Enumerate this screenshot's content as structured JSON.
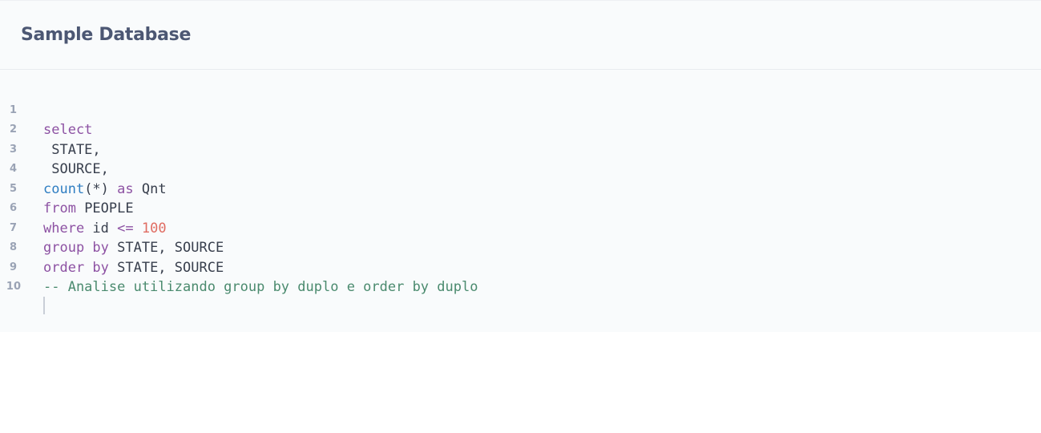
{
  "header": {
    "title": "Sample Database"
  },
  "editor": {
    "line_numbers": [
      "1",
      "2",
      "3",
      "4",
      "5",
      "6",
      "7",
      "8",
      "9",
      "10"
    ],
    "lines": {
      "l1": {
        "kw": "select"
      },
      "l2": {
        "text": " STATE,"
      },
      "l3": {
        "text": " SOURCE,"
      },
      "l4": {
        "fn": "count",
        "text1": "(*) ",
        "kw": "as",
        "text2": " Qnt"
      },
      "l5": {
        "kw": "from",
        "text": " PEOPLE"
      },
      "l6": {
        "kw": "where",
        "text": " id ",
        "op": "<=",
        "sp": " ",
        "num": "100"
      },
      "l7": {
        "kw": "group by",
        "text": " STATE, SOURCE"
      },
      "l8": {
        "kw": "order by",
        "text": " STATE, SOURCE"
      },
      "l9": {
        "comment": "-- Analise utilizando group by duplo e order by duplo"
      }
    }
  },
  "colors": {
    "keyword": "#8d52a3",
    "function": "#2f7ec2",
    "number": "#e06c62",
    "comment": "#4a8a6e",
    "text": "#383f4d",
    "title": "#4c5773"
  }
}
